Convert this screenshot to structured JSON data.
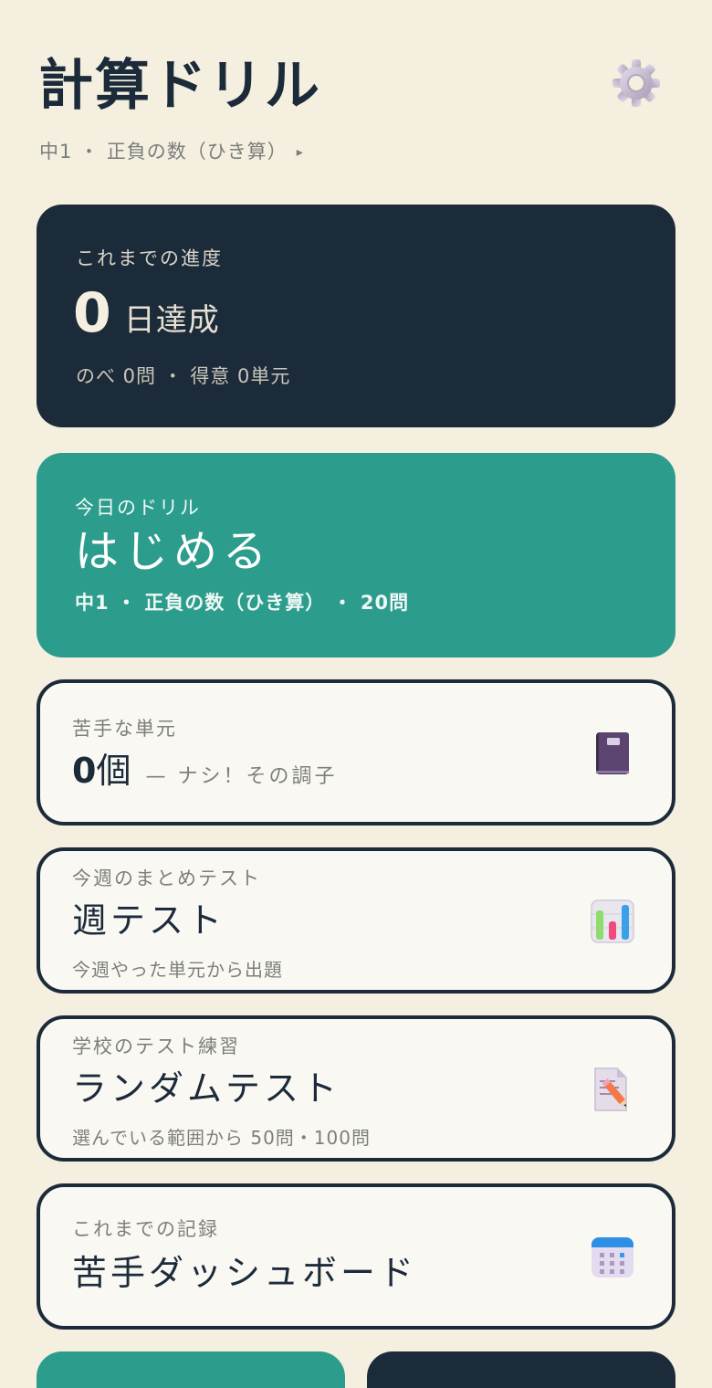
{
  "header": {
    "title": "計算ドリル",
    "subtitle": "中1 ・ 正負の数（ひき算）",
    "subtitle_caret": "▸"
  },
  "progress": {
    "label": "これまでの進度",
    "days": "0",
    "days_unit": "日達成",
    "stats": "のべ 0問 ・ 得意 0単元"
  },
  "today": {
    "label": "今日のドリル",
    "action": "はじめる",
    "meta": "中1 ・ 正負の数（ひき算） ・ 20問"
  },
  "weak_units": {
    "label": "苦手な単元",
    "count": "0",
    "count_unit": "個",
    "note": "— ナシ！その調子",
    "icon": "notebook-icon"
  },
  "weekly_test": {
    "label": "今週のまとめテスト",
    "title": "週テスト",
    "sub": "今週やった単元から出題",
    "icon": "bar-chart-icon"
  },
  "random_test": {
    "label": "学校のテスト練習",
    "title": "ランダムテスト",
    "sub": "選んでいる範囲から 50問・100問",
    "icon": "memo-pencil-icon"
  },
  "dashboard": {
    "label": "これまでの記録",
    "title": "苦手ダッシュボード",
    "icon": "calendar-icon"
  },
  "colors": {
    "background": "#f5efe0",
    "navy": "#1c2b3a",
    "teal": "#2c9d8c"
  }
}
